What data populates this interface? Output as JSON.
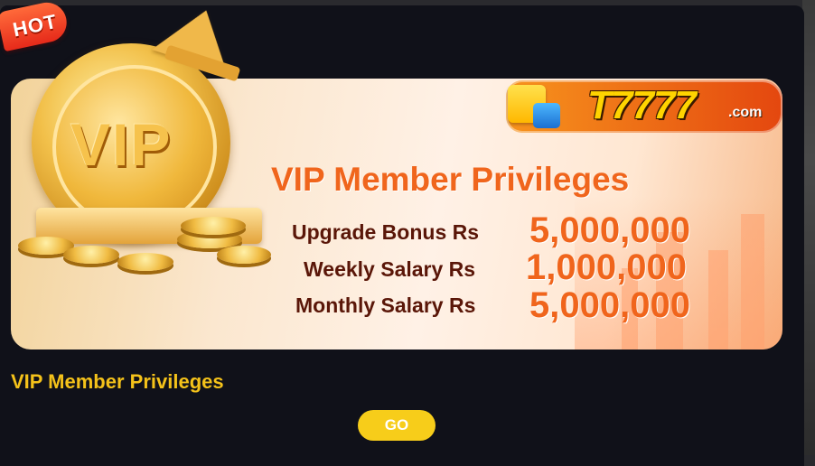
{
  "banner": {
    "hot_label": "HOT",
    "coin_label": "VIP",
    "logo_text": "T7777",
    "logo_suffix": ".com",
    "headline": "VIP Member Privileges",
    "rows": [
      {
        "label": "Upgrade Bonus Rs",
        "value": "5,000,000"
      },
      {
        "label": "Weekly Salary Rs",
        "value": "1,000,000"
      },
      {
        "label": "Monthly Salary Rs",
        "value": "5,000,000"
      }
    ]
  },
  "card": {
    "title": "VIP Member Privileges",
    "go_label": "GO"
  },
  "colors": {
    "accent_yellow": "#f7cd1a",
    "title_gold": "#f4c21a",
    "banner_orange": "#f0651c",
    "panel_bg": "#101119"
  }
}
